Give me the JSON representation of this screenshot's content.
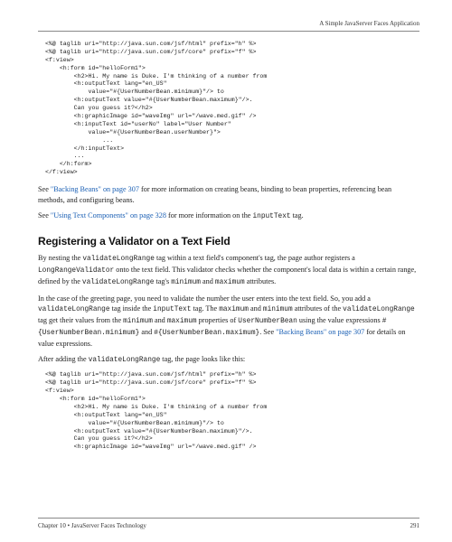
{
  "running_head": "A Simple JavaServer Faces Application",
  "code_block_1": "<%@ taglib uri=\"http://java.sun.com/jsf/html\" prefix=\"h\" %>\n<%@ taglib uri=\"http://java.sun.com/jsf/core\" prefix=\"f\" %>\n<f:view>\n    <h:form id=\"helloForm1\">\n        <h2>Hi. My name is Duke. I'm thinking of a number from\n        <h:outputText lang=\"en_US\"\n            value=\"#{UserNumberBean.minimum}\"/> to\n        <h:outputText value=\"#{UserNumberBean.maximum}\"/>.\n        Can you guess it?</h2>\n        <h:graphicImage id=\"waveImg\" url=\"/wave.med.gif\" />\n        <h:inputText id=\"userNo\" label=\"User Number\"\n            value=\"#{UserNumberBean.userNumber}\">\n                ...\n        </h:inputText>\n        ...\n    </h:form>\n</f:view>",
  "para1_pre": "See ",
  "para1_link": "\"Backing Beans\" on page 307",
  "para1_post": " for more information on creating beans, binding to bean properties, referencing bean methods, and configuring beans.",
  "para2_pre": "See ",
  "para2_link": "\"Using Text Components\" on page 328",
  "para2_post_a": " for more information on the ",
  "para2_mono": "inputText",
  "para2_post_b": " tag.",
  "section_heading": "Registering a Validator on a Text Field",
  "para3_a": "By nesting the ",
  "para3_m1": "validateLongRange",
  "para3_b": " tag within a text field's component's tag, the page author registers a ",
  "para3_m2": "LongRangeValidator",
  "para3_c": " onto the text field. This validator checks whether the component's local data is within a certain range, defined by the ",
  "para3_m3": "validateLongRange",
  "para3_d": " tag's ",
  "para3_m4": "minimum",
  "para3_e": " and ",
  "para3_m5": "maximum",
  "para3_f": " attributes.",
  "para4_a": "In the case of the greeting page, you need to validate the number the user enters into the text field. So, you add a ",
  "para4_m1": "validateLongRange",
  "para4_b": " tag inside the ",
  "para4_m2": "inputText",
  "para4_c": " tag. The ",
  "para4_m3": "maximum",
  "para4_d": " and ",
  "para4_m4": "minimum",
  "para4_e": " attributes of the ",
  "para4_m5": "validateLongRange",
  "para4_f": " tag get their values from the ",
  "para4_m6": "minimum",
  "para4_g": " and ",
  "para4_m7": "maximum",
  "para4_h": " properties of ",
  "para4_m8": "UserNumberBean",
  "para4_i": " using the value expressions ",
  "para4_m9": "#{UserNumberBean.minimum}",
  "para4_j": " and ",
  "para4_m10": "#{UserNumberBean.maximum}",
  "para4_k": ". See ",
  "para4_link": "\"Backing Beans\" on page 307",
  "para4_l": " for details on value expressions.",
  "para5_a": "After adding the ",
  "para5_m1": "validateLongRange",
  "para5_b": " tag, the page looks like this:",
  "code_block_2": "<%@ taglib uri=\"http://java.sun.com/jsf/html\" prefix=\"h\" %>\n<%@ taglib uri=\"http://java.sun.com/jsf/core\" prefix=\"f\" %>\n<f:view>\n    <h:form id=\"helloForm1\">\n        <h2>Hi. My name is Duke. I'm thinking of a number from\n        <h:outputText lang=\"en_US\"\n            value=\"#{UserNumberBean.minimum}\"/> to\n        <h:outputText value=\"#{UserNumberBean.maximum}\"/>.\n        Can you guess it?</h2>\n        <h:graphicImage id=\"waveImg\" url=\"/wave.med.gif\" />",
  "footer_left": "Chapter 10 • JavaServer Faces Technology",
  "footer_right": "291"
}
